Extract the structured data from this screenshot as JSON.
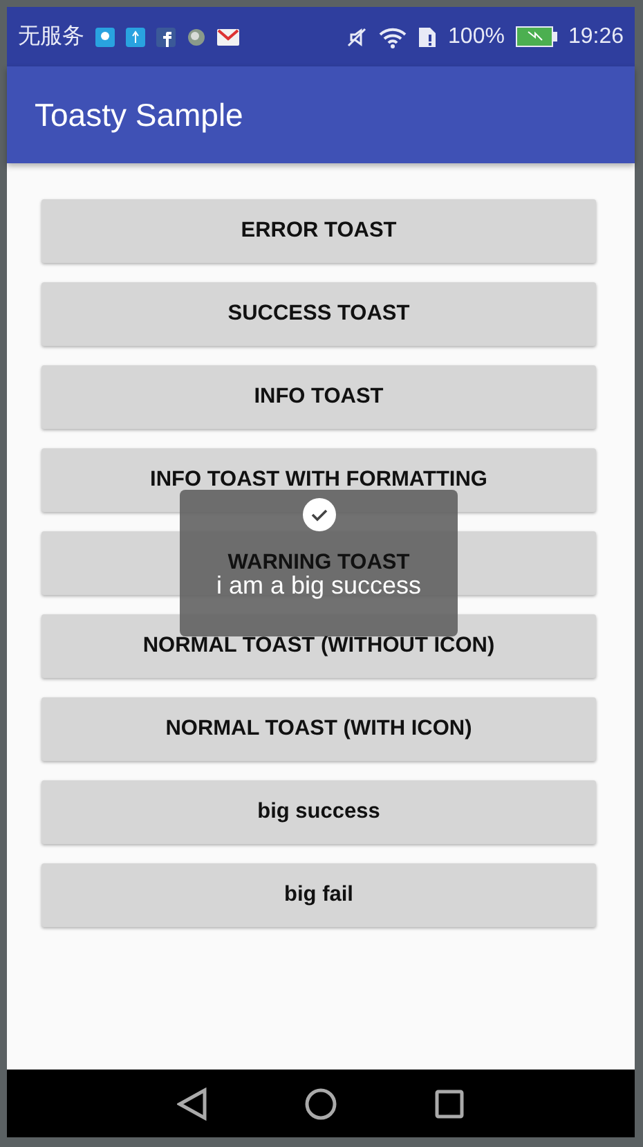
{
  "status_bar": {
    "carrier": "无服务",
    "battery": "100%",
    "time": "19:26"
  },
  "app_bar": {
    "title": "Toasty Sample"
  },
  "buttons": [
    {
      "label": "ERROR TOAST"
    },
    {
      "label": "SUCCESS TOAST"
    },
    {
      "label": "INFO TOAST"
    },
    {
      "label": "INFO TOAST WITH FORMATTING"
    },
    {
      "label": "WARNING TOAST"
    },
    {
      "label": "NORMAL TOAST (WITHOUT ICON)"
    },
    {
      "label": "NORMAL TOAST (WITH ICON)"
    },
    {
      "label": "big success"
    },
    {
      "label": "big fail"
    }
  ],
  "toast": {
    "kind": "success",
    "message": "i am a big success"
  }
}
